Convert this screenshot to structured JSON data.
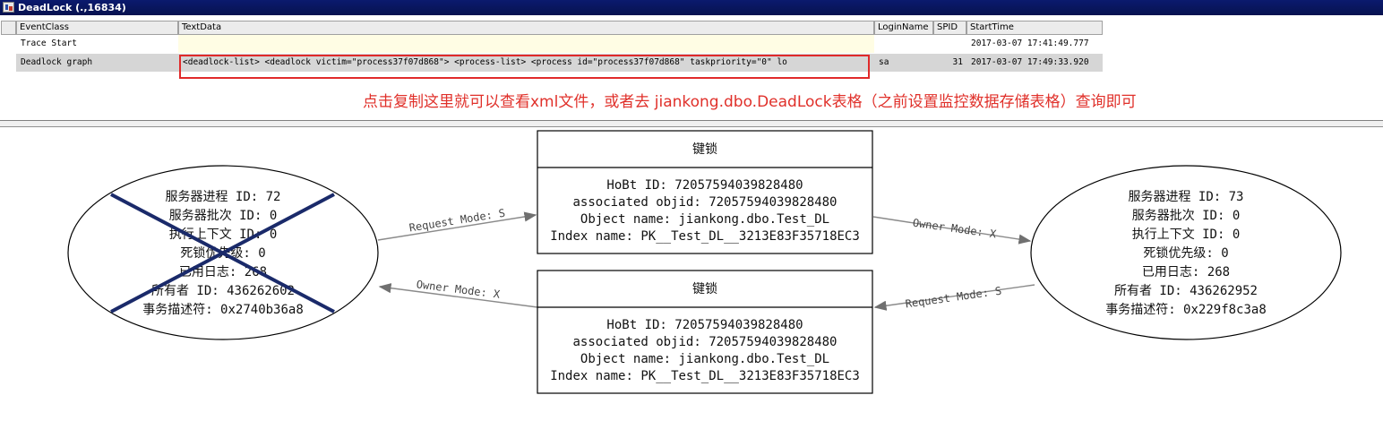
{
  "window": {
    "title": "DeadLock (.,16834)"
  },
  "grid": {
    "columns": [
      "EventClass",
      "TextData",
      "LoginName",
      "SPID",
      "StartTime"
    ],
    "rows": [
      {
        "event_class": "Trace Start",
        "text_data": "",
        "login_name": "",
        "spid": "",
        "start_time": "2017-03-07 17:41:49.777"
      },
      {
        "event_class": "Deadlock graph",
        "text_data": "<deadlock-list>   <deadlock victim=\"process37f07d868\">   <process-list>    <process id=\"process37f07d868\" taskpriority=\"0\" lo",
        "login_name": "sa",
        "spid": "31",
        "start_time": "2017-03-07 17:49:33.920"
      }
    ],
    "annotation": "点击复制这里就可以查看xml文件，或者去 jiankong.dbo.DeadLock表格（之前设置监控数据存储表格）查询即可"
  },
  "graph": {
    "process_left": {
      "victim": true,
      "lines": [
        "服务器进程 ID: 72",
        "服务器批次 ID: 0",
        "执行上下文 ID: 0",
        "死锁优先级: 0",
        "已用日志: 268",
        "所有者 ID: 436262602",
        "事务描述符: 0x2740b36a8"
      ]
    },
    "process_right": {
      "victim": false,
      "lines": [
        "服务器进程 ID: 73",
        "服务器批次 ID: 0",
        "执行上下文 ID: 0",
        "死锁优先级: 0",
        "已用日志: 268",
        "所有者 ID: 436262952",
        "事务描述符: 0x229f8c3a8"
      ]
    },
    "resource_top": {
      "title": "键锁",
      "lines": [
        "HoBt ID: 72057594039828480",
        "associated objid: 72057594039828480",
        "Object name: jiankong.dbo.Test_DL",
        "Index name: PK__Test_DL__3213E83F35718EC3"
      ]
    },
    "resource_bottom": {
      "title": "键锁",
      "lines": [
        "HoBt ID: 72057594039828480",
        "associated objid: 72057594039828480",
        "Object name: jiankong.dbo.Test_DL",
        "Index name: PK__Test_DL__3213E83F35718EC3"
      ]
    },
    "edges": {
      "left_to_top": "Request Mode: S",
      "top_to_right": "Owner Mode: X",
      "right_to_bottom": "Request Mode: S",
      "bottom_to_left": "Owner Mode: X"
    }
  }
}
